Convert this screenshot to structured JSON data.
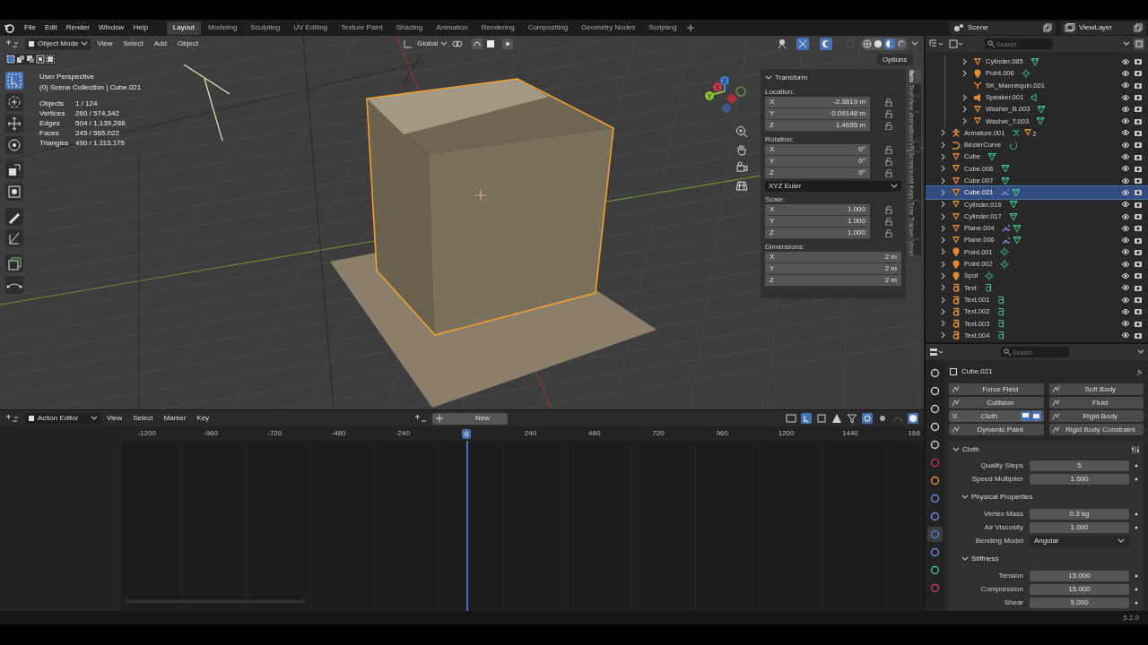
{
  "menu": [
    "File",
    "Edit",
    "Render",
    "Window",
    "Help"
  ],
  "workspaces": [
    {
      "label": "Layout",
      "selected": true
    },
    {
      "label": "Modeling",
      "selected": false
    },
    {
      "label": "Sculpting",
      "selected": false
    },
    {
      "label": "UV Editing",
      "selected": false
    },
    {
      "label": "Texture Paint",
      "selected": false
    },
    {
      "label": "Shading",
      "selected": false
    },
    {
      "label": "Animation",
      "selected": false
    },
    {
      "label": "Rendering",
      "selected": false
    },
    {
      "label": "Compositing",
      "selected": false
    },
    {
      "label": "Geometry Nodes",
      "selected": false
    },
    {
      "label": "Scripting",
      "selected": false
    }
  ],
  "scene": "Scene",
  "view_layer": "ViewLayer",
  "viewport": {
    "mode": "Object Mode",
    "menus": [
      "View",
      "Select",
      "Add",
      "Object"
    ],
    "orientation": "Global",
    "options": "Options",
    "view_name": "User Perspective",
    "collection": "(0) Scene Collection | Cube.021",
    "stats": [
      {
        "label": "Objects",
        "value": "1 / 124"
      },
      {
        "label": "Vertices",
        "value": "260 / 574,342"
      },
      {
        "label": "Edges",
        "value": "504 / 1,139,286"
      },
      {
        "label": "Faces",
        "value": "245 / 565,022"
      },
      {
        "label": "Triangles",
        "value": "490 / 1,113,175"
      }
    ],
    "tools": [
      {
        "selected": true
      },
      {
        "selected": false
      },
      {
        "selected": false
      },
      {
        "selected": false
      },
      {
        "selected": false
      },
      {
        "selected": false
      },
      {
        "selected": false
      },
      {
        "selected": false
      },
      {
        "selected": false
      },
      {
        "selected": false
      }
    ],
    "gizmo_axes": [
      "Z",
      "X",
      "Y"
    ],
    "sidebar_tabs": [
      {
        "label": "Item",
        "selected": true
      },
      {
        "label": "Tool",
        "selected": false
      },
      {
        "label": "View",
        "selected": false
      },
      {
        "label": "Animation",
        "selected": false
      },
      {
        "label": "VR",
        "selected": false
      },
      {
        "label": "Screencast Keys",
        "selected": false
      },
      {
        "label": "Time Tracker",
        "selected": false
      },
      {
        "label": "Voxel",
        "selected": false
      }
    ],
    "transform": {
      "title": "Transform",
      "sections": [
        {
          "kind": "vector",
          "label": "Location:",
          "lock": true,
          "fields": [
            {
              "axis": "X",
              "value": "-2.3819 m"
            },
            {
              "axis": "Y",
              "value": "0.09148 m"
            },
            {
              "axis": "Z",
              "value": "1.4655 m"
            }
          ]
        },
        {
          "kind": "vector",
          "label": "Rotation:",
          "lock": true,
          "fields": [
            {
              "axis": "X",
              "value": "0°"
            },
            {
              "axis": "Y",
              "value": "0°"
            },
            {
              "axis": "Z",
              "value": "0°"
            }
          ]
        },
        {
          "kind": "dropdown",
          "value": "XYZ Euler"
        },
        {
          "kind": "vector",
          "label": "Scale:",
          "lock": true,
          "fields": [
            {
              "axis": "X",
              "value": "1.000"
            },
            {
              "axis": "Y",
              "value": "1.000"
            },
            {
              "axis": "Z",
              "value": "1.000"
            }
          ]
        },
        {
          "kind": "vector",
          "label": "Dimensions:",
          "lock": false,
          "fields": [
            {
              "axis": "X",
              "value": "2 m"
            },
            {
              "axis": "Y",
              "value": "2 m"
            },
            {
              "axis": "Z",
              "value": "2 m"
            }
          ]
        }
      ]
    }
  },
  "timeline": {
    "editor": "Action Editor",
    "menus": [
      "View",
      "Select",
      "Marker",
      "Key"
    ],
    "new_button": "New",
    "ticks": [
      {
        "label": "-1200",
        "selected": false
      },
      {
        "label": "-960",
        "selected": false
      },
      {
        "label": "-720",
        "selected": false
      },
      {
        "label": "-480",
        "selected": false
      },
      {
        "label": "-240",
        "selected": false
      },
      {
        "label": "0",
        "selected": true
      },
      {
        "label": "240",
        "selected": false
      },
      {
        "label": "480",
        "selected": false
      },
      {
        "label": "720",
        "selected": false
      },
      {
        "label": "960",
        "selected": false
      },
      {
        "label": "1200",
        "selected": false
      },
      {
        "label": "1440",
        "selected": false
      },
      {
        "label": "168",
        "selected": false
      }
    ]
  },
  "outliner": {
    "search_placeholder": "Search",
    "items": [
      {
        "children": [
          {
            "name": "Cylinder.085",
            "kind": "mesh",
            "expandable": true,
            "selected": false,
            "modifier": false
          },
          {
            "name": "Point.006",
            "kind": "light",
            "expandable": true,
            "selected": false,
            "modifier": false
          },
          {
            "name": "SK_Mannequin.001",
            "kind": "bone",
            "expandable": false,
            "selected": false,
            "modifier": false
          },
          {
            "name": "Speaker.001",
            "kind": "speaker",
            "expandable": true,
            "selected": false,
            "modifier": false
          },
          {
            "name": "Washer_B.003",
            "kind": "mesh",
            "expandable": true,
            "selected": false,
            "modifier": false
          },
          {
            "name": "Washer_T.003",
            "kind": "mesh",
            "expandable": true,
            "selected": false,
            "modifier": false
          }
        ]
      },
      {
        "name": "Armature.001",
        "kind": "armature",
        "expandable": true,
        "selected": false,
        "modifier": false,
        "child_count": "2"
      },
      {
        "name": "BézierCurve",
        "kind": "curve",
        "expandable": true,
        "selected": false,
        "modifier": false
      },
      {
        "name": "Cube",
        "kind": "mesh",
        "expandable": true,
        "selected": false,
        "modifier": false
      },
      {
        "name": "Cube.006",
        "kind": "mesh",
        "expandable": true,
        "selected": false,
        "modifier": false
      },
      {
        "name": "Cube.007",
        "kind": "mesh",
        "expandable": true,
        "selected": false,
        "modifier": false
      },
      {
        "name": "Cube.021",
        "kind": "mesh",
        "expandable": true,
        "selected": true,
        "modifier": true
      },
      {
        "name": "Cylinder.016",
        "kind": "mesh",
        "expandable": true,
        "selected": false,
        "modifier": false
      },
      {
        "name": "Cylinder.017",
        "kind": "mesh",
        "expandable": true,
        "selected": false,
        "modifier": false
      },
      {
        "name": "Plane.004",
        "kind": "mesh",
        "expandable": true,
        "selected": false,
        "modifier": true
      },
      {
        "name": "Plane.006",
        "kind": "mesh",
        "expandable": true,
        "selected": false,
        "modifier": true
      },
      {
        "name": "Point.001",
        "kind": "light",
        "expandable": true,
        "selected": false,
        "modifier": false
      },
      {
        "name": "Point.002",
        "kind": "light",
        "expandable": true,
        "selected": false,
        "modifier": false
      },
      {
        "name": "Spot",
        "kind": "light",
        "expandable": true,
        "selected": false,
        "modifier": false
      },
      {
        "name": "Text",
        "kind": "text",
        "expandable": true,
        "selected": false,
        "modifier": false
      },
      {
        "name": "Text.001",
        "kind": "text",
        "expandable": true,
        "selected": false,
        "modifier": false
      },
      {
        "name": "Text.002",
        "kind": "text",
        "expandable": true,
        "selected": false,
        "modifier": false
      },
      {
        "name": "Text.003",
        "kind": "text",
        "expandable": true,
        "selected": false,
        "modifier": false
      },
      {
        "name": "Text.004",
        "kind": "text",
        "expandable": true,
        "selected": false,
        "modifier": false
      }
    ]
  },
  "properties": {
    "search_placeholder": "Search",
    "object_name": "Cube.021",
    "tabs": [
      {
        "kind": "tool",
        "selected": false
      },
      {
        "kind": "render",
        "selected": false
      },
      {
        "kind": "output",
        "selected": false
      },
      {
        "kind": "view_layer",
        "selected": false
      },
      {
        "kind": "scene",
        "selected": false
      },
      {
        "kind": "world",
        "selected": false
      },
      {
        "kind": "object",
        "selected": false
      },
      {
        "kind": "modifiers",
        "selected": false
      },
      {
        "kind": "particles",
        "selected": false
      },
      {
        "kind": "physics",
        "selected": true
      },
      {
        "kind": "constraints",
        "selected": false
      },
      {
        "kind": "data",
        "selected": false
      },
      {
        "kind": "material",
        "selected": false
      }
    ],
    "physics_buttons": [
      {
        "label": "Force Field",
        "enabled": false
      },
      {
        "label": "Soft Body",
        "enabled": false
      },
      {
        "label": "Collision",
        "enabled": false
      },
      {
        "label": "Fluid",
        "enabled": false
      },
      {
        "label": "Cloth",
        "enabled": true
      },
      {
        "label": "Rigid Body",
        "enabled": false
      },
      {
        "label": "Dynamic Paint",
        "enabled": false
      },
      {
        "label": "Rigid Body Constraint",
        "enabled": false
      }
    ],
    "cloth": {
      "title": "Cloth",
      "expanded": true,
      "fields": [
        {
          "kind": "number",
          "label": "Quality Steps",
          "value": "5"
        },
        {
          "kind": "number",
          "label": "Speed Multiplier",
          "value": "1.000"
        }
      ],
      "subpanels": [
        {
          "title": "Physical Properties",
          "expanded": true,
          "fields": [
            {
              "kind": "number",
              "label": "Vertex Mass",
              "value": "0.3 kg"
            },
            {
              "kind": "number",
              "label": "Air Viscosity",
              "value": "1.000"
            },
            {
              "kind": "dropdown",
              "label": "Bending Model",
              "value": "Angular"
            }
          ]
        },
        {
          "title": "Stiffness",
          "expanded": true,
          "fields": [
            {
              "kind": "number",
              "label": "Tension",
              "value": "15.000"
            },
            {
              "kind": "number",
              "label": "Compression",
              "value": "15.000"
            },
            {
              "kind": "number",
              "label": "Shear",
              "value": "5.000"
            }
          ]
        }
      ]
    }
  },
  "version": "5.2.0"
}
